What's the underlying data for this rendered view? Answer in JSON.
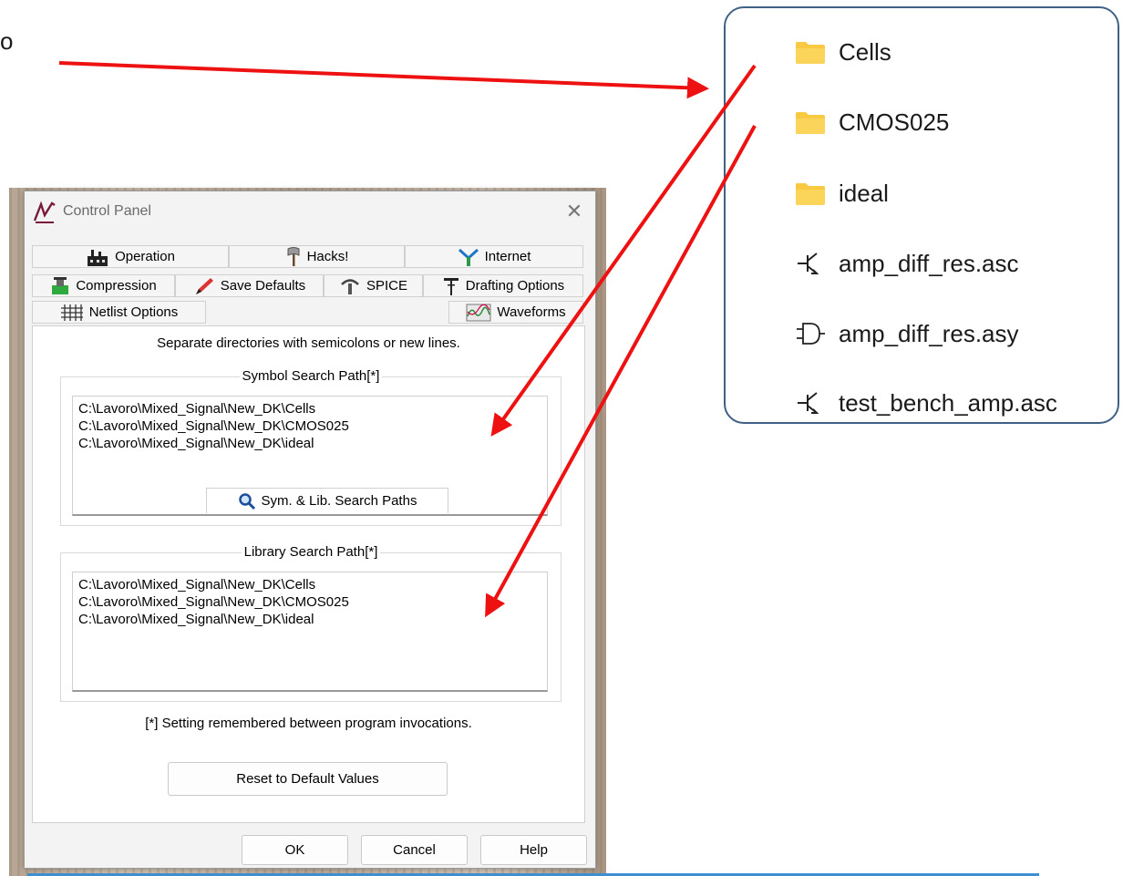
{
  "edge_text": "o",
  "window": {
    "title": "Control Panel",
    "close_symbol": "✕"
  },
  "tabs": [
    {
      "label": "Operation",
      "icon": "factory-icon"
    },
    {
      "label": "Hacks!",
      "icon": "axe-icon"
    },
    {
      "label": "Internet",
      "icon": "network-icon"
    },
    {
      "label": "Compression",
      "icon": "compressor-icon"
    },
    {
      "label": "Save Defaults",
      "icon": "pencil-icon"
    },
    {
      "label": "SPICE",
      "icon": "spice-icon"
    },
    {
      "label": "Drafting Options",
      "icon": "drafting-icon"
    },
    {
      "label": "Netlist Options",
      "icon": "grid-icon"
    },
    {
      "label": "Sym. & Lib. Search Paths",
      "icon": "magnifier-icon",
      "active": true
    },
    {
      "label": "Waveforms",
      "icon": "waveform-icon"
    }
  ],
  "content": {
    "hint": "Separate directories with semicolons or new lines.",
    "symbol_search": {
      "label": "Symbol Search Path[*]",
      "paths": "C:\\Lavoro\\Mixed_Signal\\New_DK\\Cells\nC:\\Lavoro\\Mixed_Signal\\New_DK\\CMOS025\nC:\\Lavoro\\Mixed_Signal\\New_DK\\ideal"
    },
    "library_search": {
      "label": "Library Search Path[*]",
      "paths": "C:\\Lavoro\\Mixed_Signal\\New_DK\\Cells\nC:\\Lavoro\\Mixed_Signal\\New_DK\\CMOS025\nC:\\Lavoro\\Mixed_Signal\\New_DK\\ideal"
    },
    "footnote": "[*] Setting remembered between program invocations.",
    "reset_label": "Reset to Default Values"
  },
  "buttons": {
    "ok": "OK",
    "cancel": "Cancel",
    "help": "Help"
  },
  "explorer": {
    "items": [
      {
        "name": "Cells",
        "icon": "folder-icon"
      },
      {
        "name": "CMOS025",
        "icon": "folder-icon"
      },
      {
        "name": "ideal",
        "icon": "folder-icon"
      },
      {
        "name": "amp_diff_res.asc",
        "icon": "schematic-icon"
      },
      {
        "name": "amp_diff_res.asy",
        "icon": "symbol-icon"
      },
      {
        "name": "test_bench_amp.asc",
        "icon": "schematic-icon"
      }
    ]
  },
  "colors": {
    "arrow": "#ee1111",
    "explorer_border": "#3f6186",
    "folder": "#f8c941",
    "bottom_rule": "#3d8fd1"
  }
}
